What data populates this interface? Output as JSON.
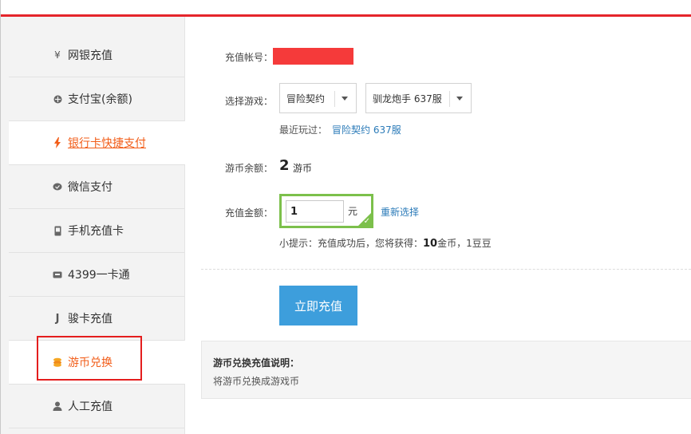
{
  "sidebar": {
    "items": [
      {
        "label": "网银充值",
        "icon": "yen-icon"
      },
      {
        "label": "支付宝(余额)",
        "icon": "alipay-icon"
      },
      {
        "label": "银行卡快捷支付",
        "icon": "lightning-icon"
      },
      {
        "label": "微信支付",
        "icon": "wechat-icon"
      },
      {
        "label": "手机充值卡",
        "icon": "phone-card-icon"
      },
      {
        "label": "4399一卡通",
        "icon": "card-icon"
      },
      {
        "label": "骏卡充值",
        "icon": "j-icon"
      },
      {
        "label": "游币兑换",
        "icon": "coins-icon"
      },
      {
        "label": "人工充值",
        "icon": "person-icon"
      }
    ]
  },
  "form": {
    "account_label": "充值帐号：",
    "game_label": "选择游戏：",
    "game_select": "冒险契约",
    "server_select": "驯龙炮手 637服",
    "recent_label": "最近玩过：",
    "recent_link": "冒险契约 637服",
    "balance_label": "游币余额：",
    "balance_value": "2",
    "balance_unit": "游币",
    "amount_label": "充值金额：",
    "amount_value": "1",
    "amount_unit": "元",
    "reselect": "重新选择",
    "tip_prefix": "小提示：充值成功后，您将获得：",
    "tip_gold": "10",
    "tip_suffix": "金币，1豆豆",
    "submit_label": "立即充值"
  },
  "explain": {
    "title": "游币兑换充值说明：",
    "desc": "将游币兑换成游戏币"
  },
  "colors": {
    "accent_red": "#e5252b",
    "link_orange": "#f25e1a",
    "button_blue": "#3d9edc",
    "link_blue": "#2a7ab8",
    "check_green": "#7cc04b"
  }
}
